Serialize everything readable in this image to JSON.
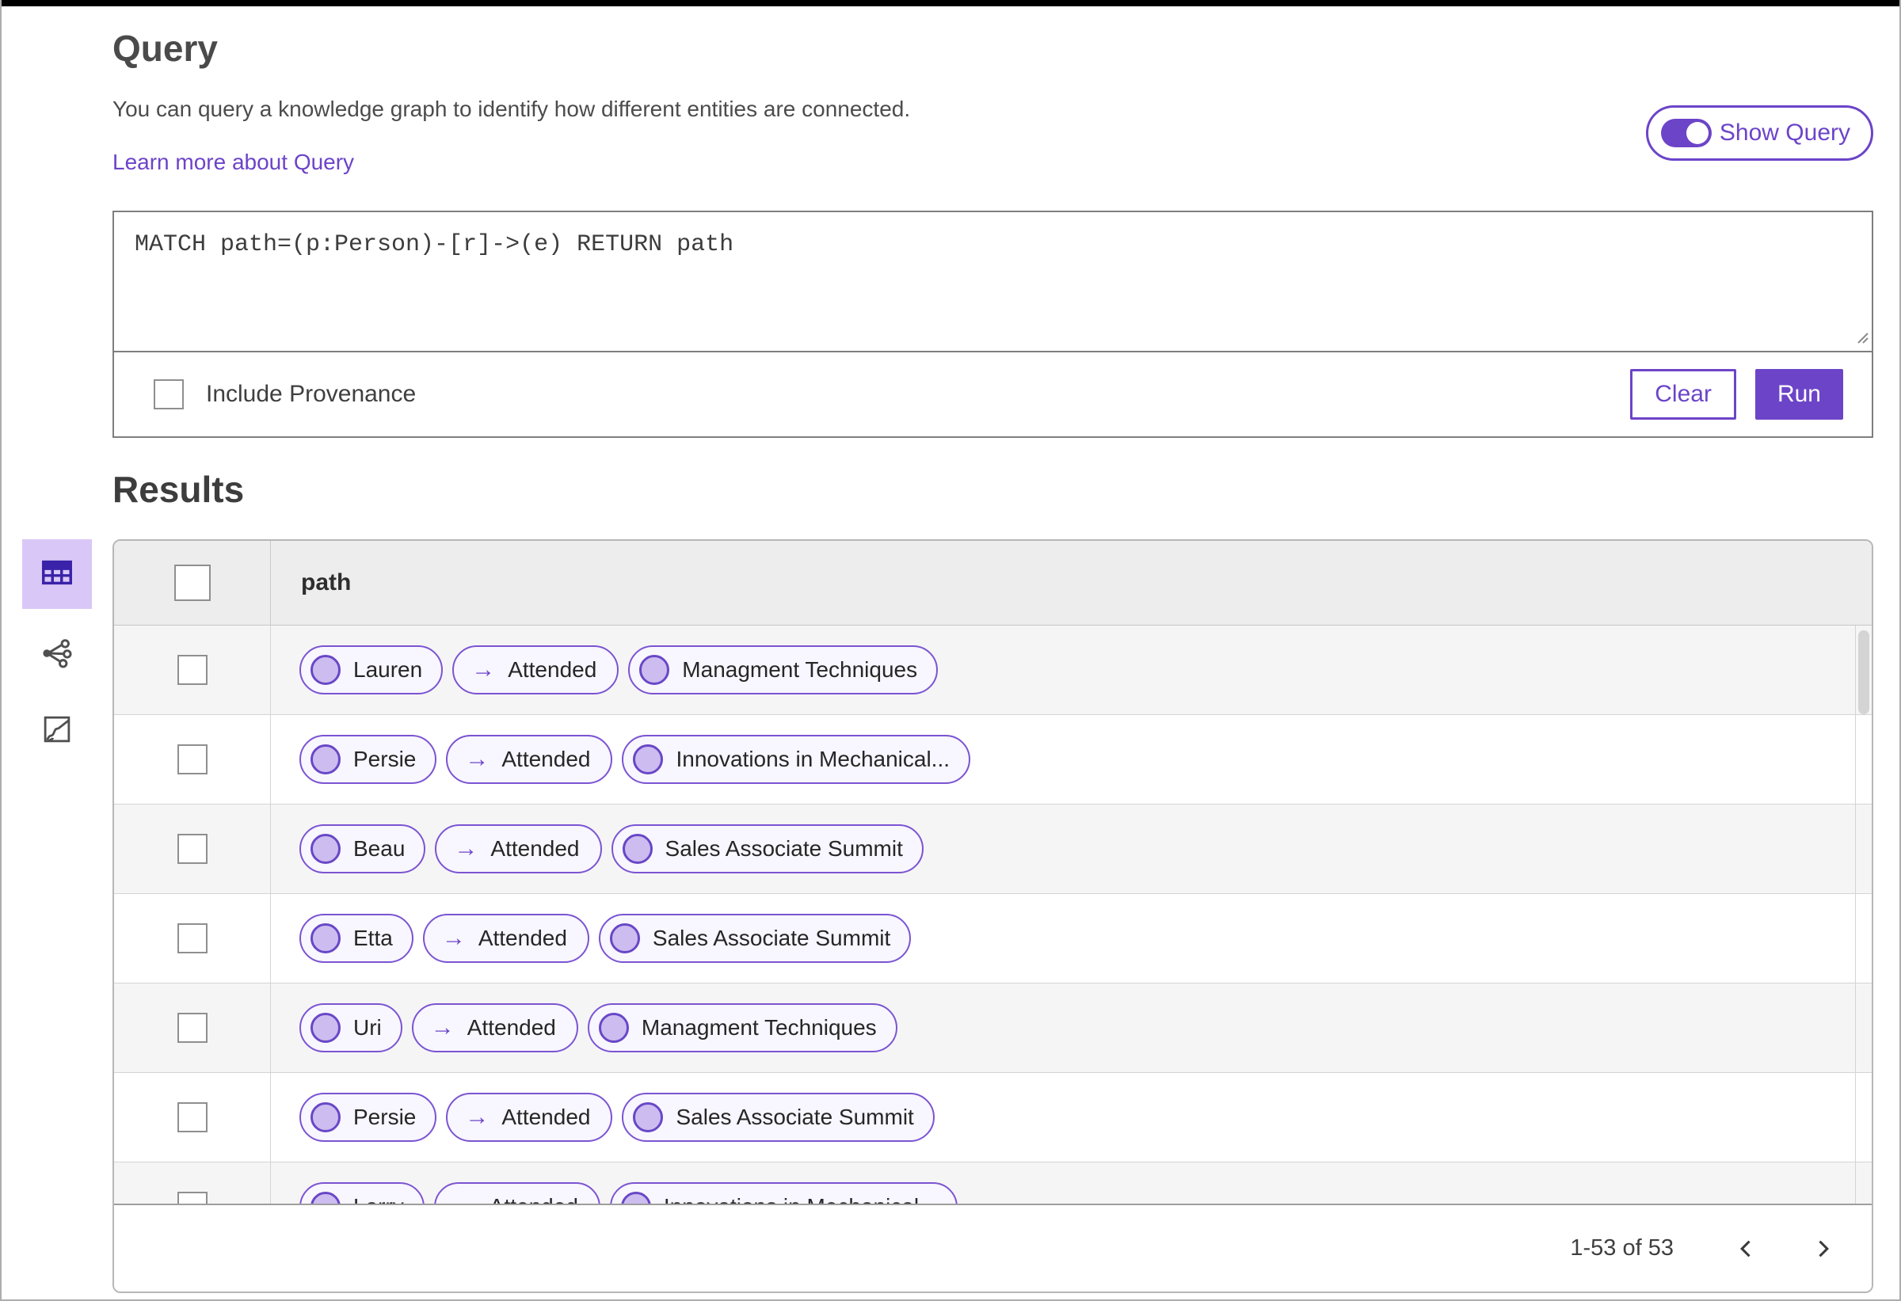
{
  "icons": {
    "arrow_right": "→"
  },
  "query": {
    "title": "Query",
    "description": "You can query a knowledge graph to identify how different entities are connected.",
    "learn_more_label": "Learn more about Query",
    "show_query_label": "Show Query",
    "editor_value": "MATCH path=(p:Person)-[r]->(e) RETURN path",
    "include_provenance_label": "Include Provenance",
    "clear_label": "Clear",
    "run_label": "Run"
  },
  "results": {
    "title": "Results",
    "column_header": "path",
    "rows": [
      {
        "source": "Lauren",
        "relation": "Attended",
        "target": "Managment Techniques"
      },
      {
        "source": "Persie",
        "relation": "Attended",
        "target": "Innovations in Mechanical..."
      },
      {
        "source": "Beau",
        "relation": "Attended",
        "target": "Sales Associate Summit"
      },
      {
        "source": "Etta",
        "relation": "Attended",
        "target": "Sales Associate Summit"
      },
      {
        "source": "Uri",
        "relation": "Attended",
        "target": "Managment Techniques"
      },
      {
        "source": "Persie",
        "relation": "Attended",
        "target": "Sales Associate Summit"
      },
      {
        "source": "Larry",
        "relation": "Attended",
        "target": "Innovations in Mechanical..."
      }
    ],
    "pagination": {
      "range_label": "1-53 of 53"
    }
  },
  "colors": {
    "accent": "#6C44C8",
    "pill_border": "#7B54D2",
    "node_fill": "#CDBCEF",
    "selected_tile": "#D9C8F7",
    "header_bg": "#EDEDED",
    "row_alt_bg": "#F5F5F5"
  }
}
